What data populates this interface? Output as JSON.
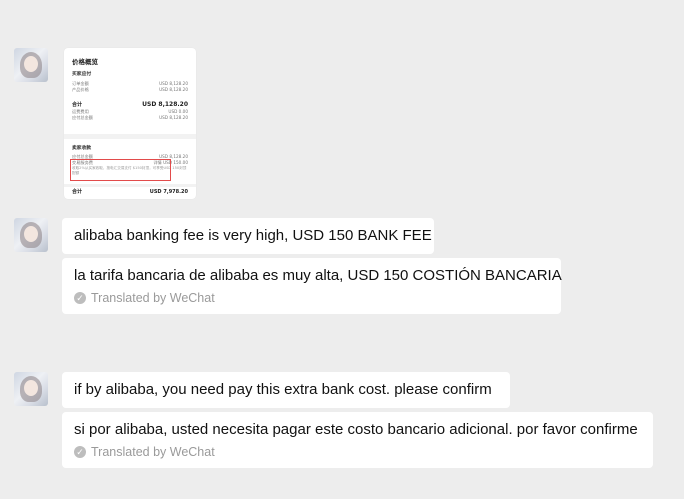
{
  "messages": [
    {
      "type": "image",
      "fee_breakdown": {
        "title": "价格概览",
        "sections": [
          {
            "heading": "买家应付",
            "rows": [
              {
                "label": "订单金额",
                "value": "USD 8,128.20"
              },
              {
                "label": "产品价格",
                "value": "USD 8,128.20"
              }
            ],
            "total": {
              "label": "合计",
              "value": "USD 8,128.20"
            },
            "rows_after": [
              {
                "label": "运费费用",
                "value": "USD 0.00"
              },
              {
                "label": "应付总金额",
                "value": "USD 8,128.20"
              }
            ]
          },
          {
            "heading": "卖家收款",
            "rows": [
              {
                "label": "应付总金额",
                "value": "USD 8,128.20"
              },
              {
                "label": "交易服务费",
                "value": "USD 150.00",
                "extra": "详情"
              }
            ],
            "note": "收取2%从买家收取，按电汇交易支付 $150封顶，可享受USD 150封顶配额",
            "total": {
              "label": "合计",
              "value": "USD 7,978.20"
            }
          }
        ]
      }
    },
    {
      "type": "text",
      "text": "alibaba banking fee is very high, USD 150 BANK FEE",
      "translation": "la tarifa bancaria de alibaba es muy alta, USD 150 COSTIÓN BANCARIA",
      "translated_by": "Translated by WeChat"
    },
    {
      "type": "text",
      "text": "if  by alibaba, you need pay this extra bank cost. please confirm",
      "translation": "si por alibaba, usted necesita pagar este costo bancario adicional. por favor confirme",
      "translated_by": "Translated by WeChat"
    }
  ],
  "icons": {
    "avatar": "user-avatar",
    "translated": "check-circle-icon"
  },
  "colors": {
    "background": "#ededed",
    "bubble": "#ffffff",
    "highlight_box": "#e24b4b",
    "muted_text": "#9a9a9a"
  }
}
